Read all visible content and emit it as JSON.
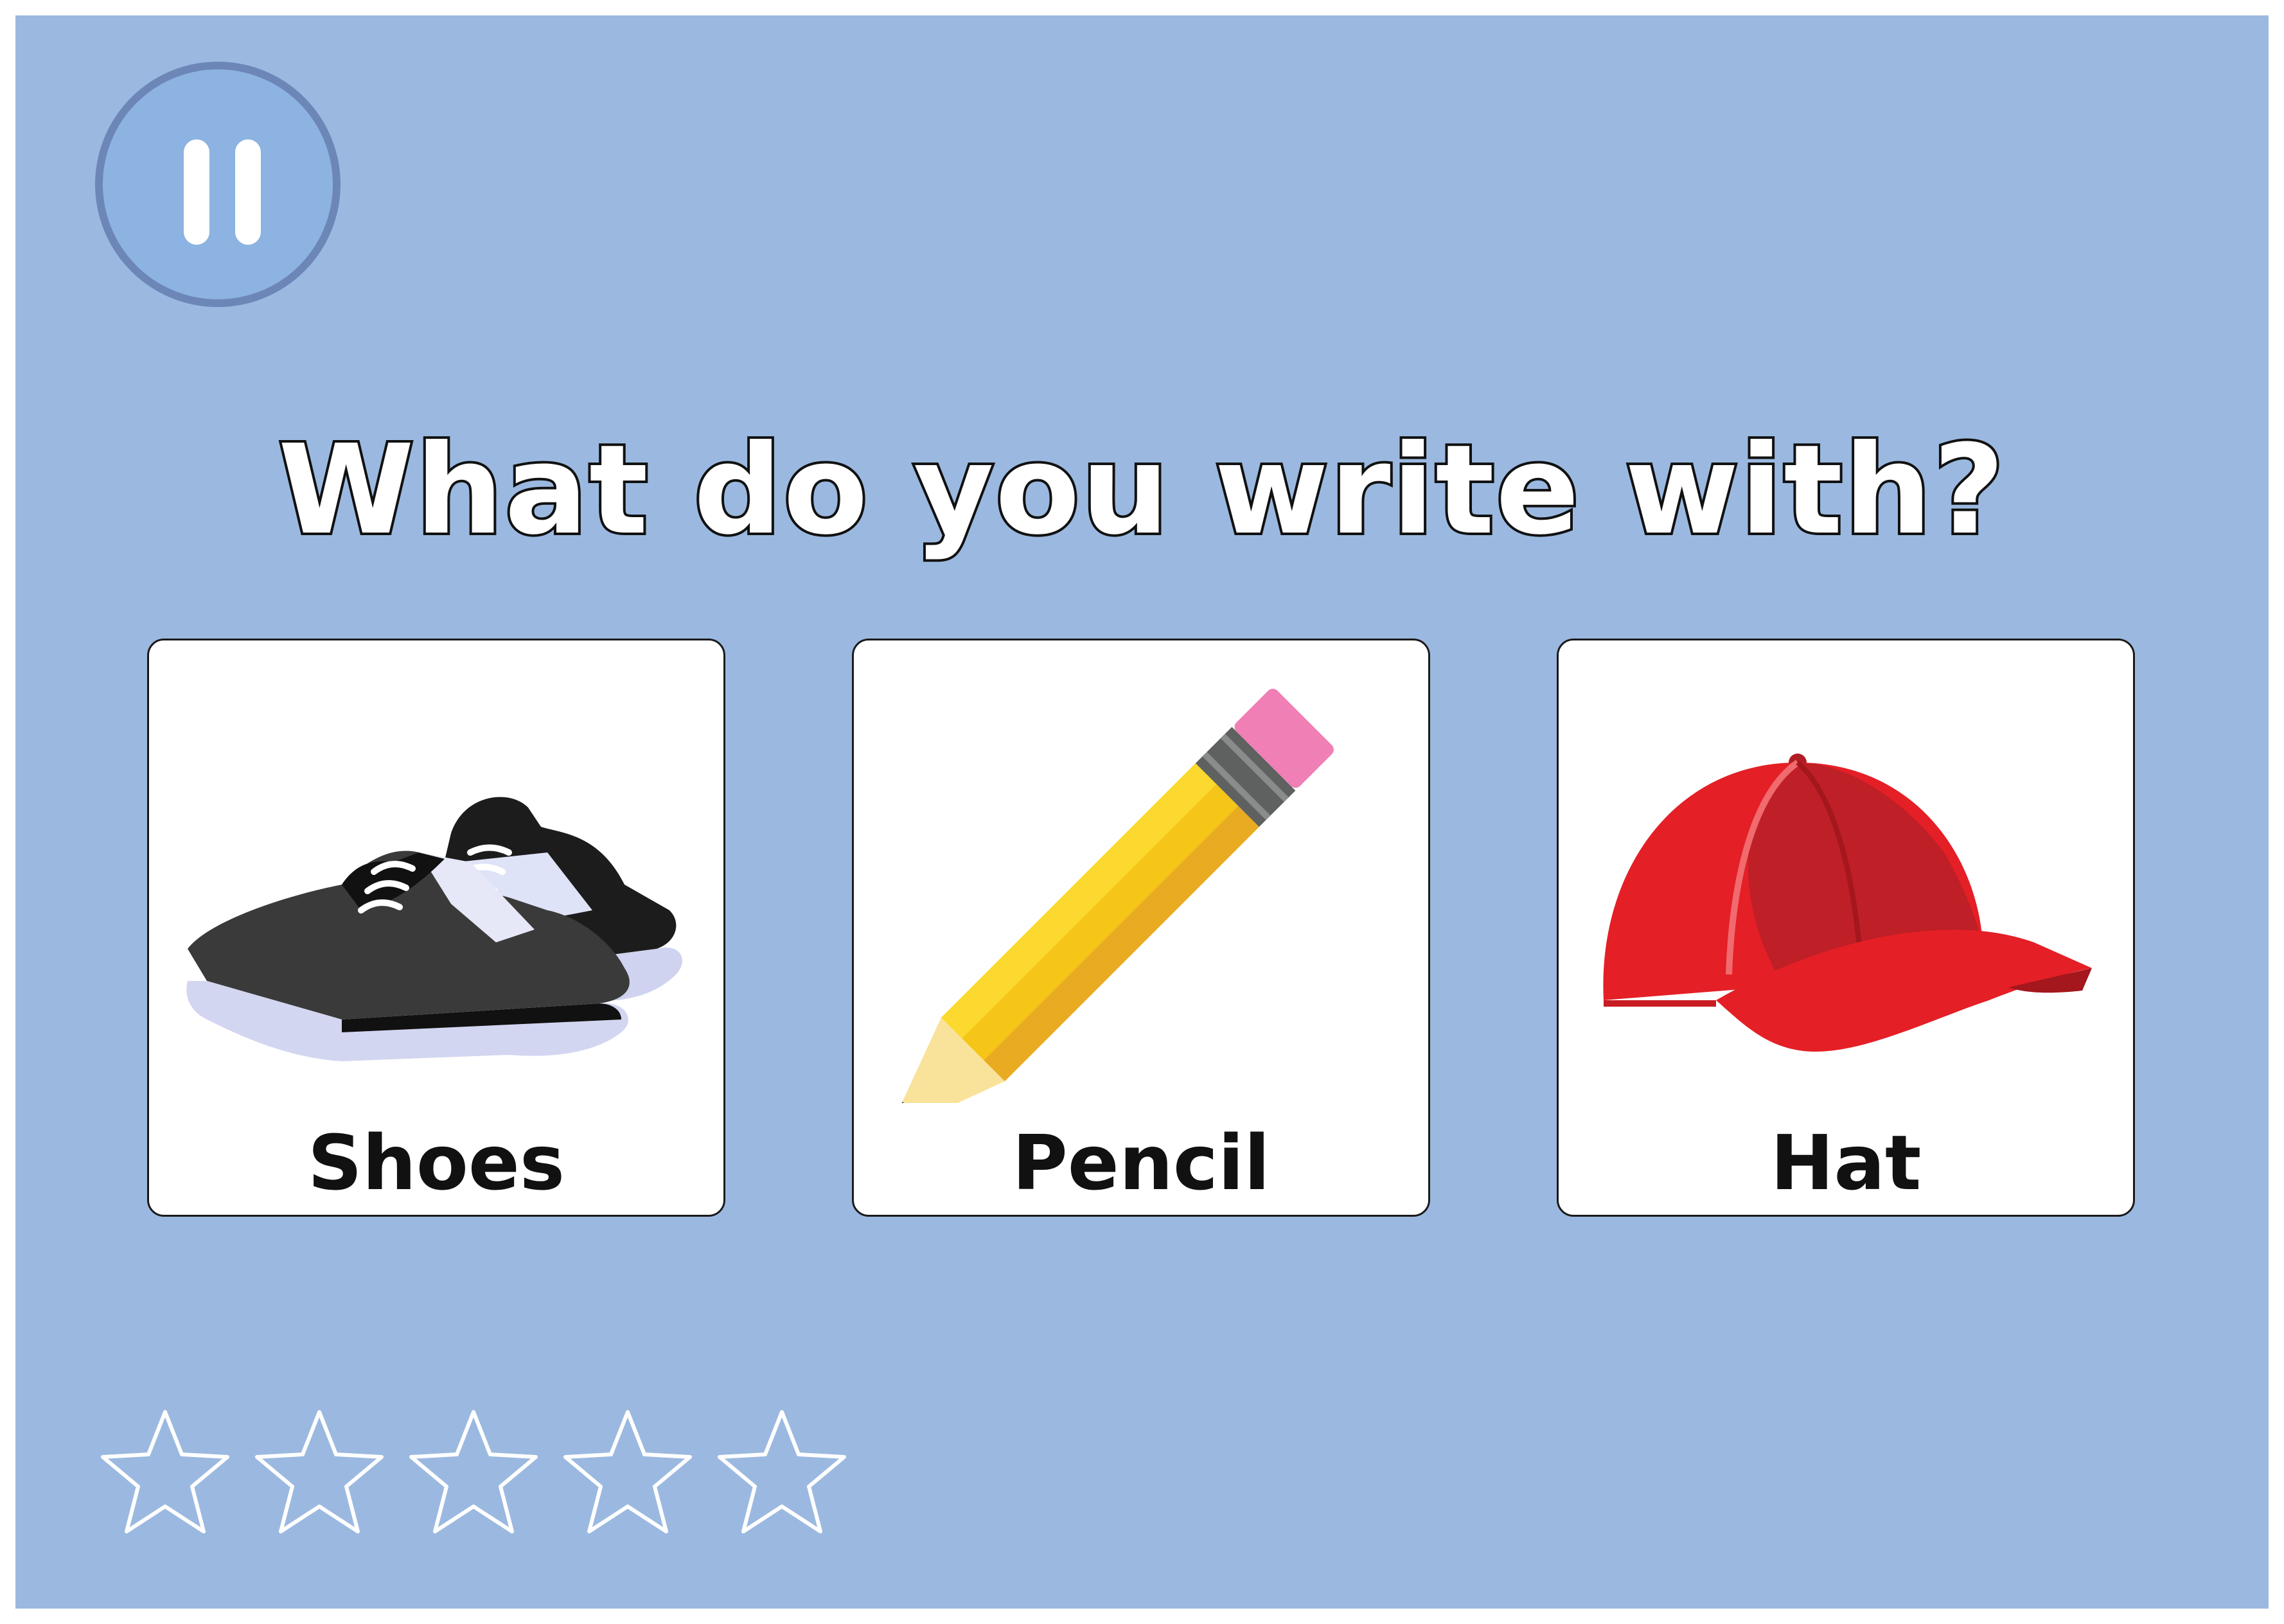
{
  "game": {
    "question": "What do you write with?",
    "background_color": "#9bb9e0",
    "pause_button": {
      "icon": "pause-icon",
      "color": "#8cb3e1"
    },
    "choices": [
      {
        "label": "Shoes",
        "icon": "shoes-icon"
      },
      {
        "label": "Pencil",
        "icon": "pencil-icon"
      },
      {
        "label": "Hat",
        "icon": "hat-icon"
      }
    ],
    "stars": {
      "earned": 0,
      "total": 5
    }
  }
}
